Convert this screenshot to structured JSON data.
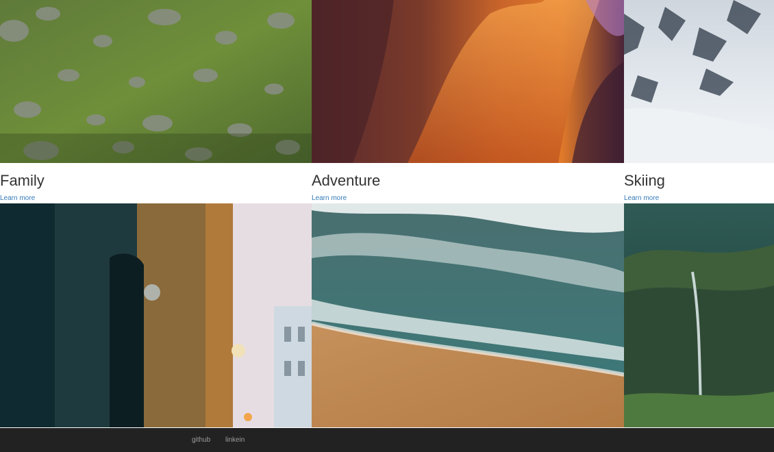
{
  "cards": [
    {
      "title": "Family",
      "link": "Learn more",
      "photo": "mossy-rocky-hillside"
    },
    {
      "title": "Adventure",
      "link": "Learn more",
      "photo": "sandstone-slot-canyon"
    },
    {
      "title": "Skiing",
      "link": "Learn more",
      "photo": "snowy-mountain-glacier"
    }
  ],
  "bottom_photos": [
    "old-town-street-buildings",
    "ocean-waves-sandy-beach",
    "waterfall-green-cliff"
  ],
  "footer": {
    "links": [
      "github",
      "linkein"
    ],
    "background": "#222222",
    "link_color": "#9d9d9d"
  },
  "colors": {
    "title": "#333333",
    "link": "#337ab7"
  }
}
